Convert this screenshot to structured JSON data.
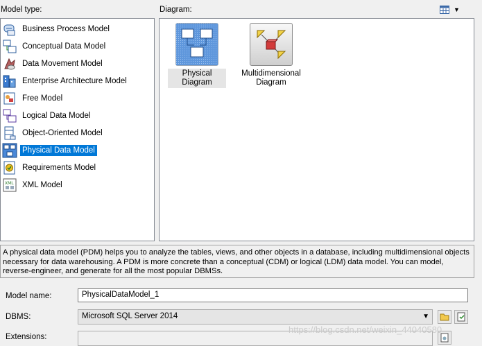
{
  "labels": {
    "model_type": "Model type:",
    "diagram": "Diagram:"
  },
  "view_menu_icon": "list-view-icon",
  "model_types": [
    {
      "label": "Business Process Model",
      "icon": "business-process-icon"
    },
    {
      "label": "Conceptual Data Model",
      "icon": "conceptual-data-icon"
    },
    {
      "label": "Data Movement Model",
      "icon": "data-movement-icon"
    },
    {
      "label": "Enterprise Architecture Model",
      "icon": "enterprise-architecture-icon"
    },
    {
      "label": "Free Model",
      "icon": "free-model-icon"
    },
    {
      "label": "Logical Data Model",
      "icon": "logical-data-icon"
    },
    {
      "label": "Object-Oriented Model",
      "icon": "object-oriented-icon"
    },
    {
      "label": "Physical Data Model",
      "icon": "physical-data-icon",
      "selected": true
    },
    {
      "label": "Requirements Model",
      "icon": "requirements-icon"
    },
    {
      "label": "XML Model",
      "icon": "xml-model-icon"
    }
  ],
  "diagrams": [
    {
      "label": "Physical Diagram",
      "icon": "physical-diagram-icon",
      "selected": true
    },
    {
      "label_line1": "Multidimensional",
      "label_line2": "Diagram",
      "icon": "multidimensional-diagram-icon"
    }
  ],
  "description": "A physical data model (PDM) helps you to analyze the tables, views, and other objects in a database, including multidimensional objects necessary for data warehousing. A PDM is more concrete than a conceptual (CDM) or logical (LDM) data model. You can model, reverse-engineer, and generate for all the most popular DBMSs.",
  "form": {
    "model_name_label": "Model name:",
    "model_name_value": "PhysicalDataModel_1",
    "dbms_label": "DBMS:",
    "dbms_value": "Microsoft SQL Server 2014",
    "extensions_label": "Extensions:",
    "extensions_value": ""
  },
  "watermark": "https://blog.csdn.net/weixin_44040580",
  "colors": {
    "selection": "#0078d7",
    "panel_border": "#828790"
  }
}
